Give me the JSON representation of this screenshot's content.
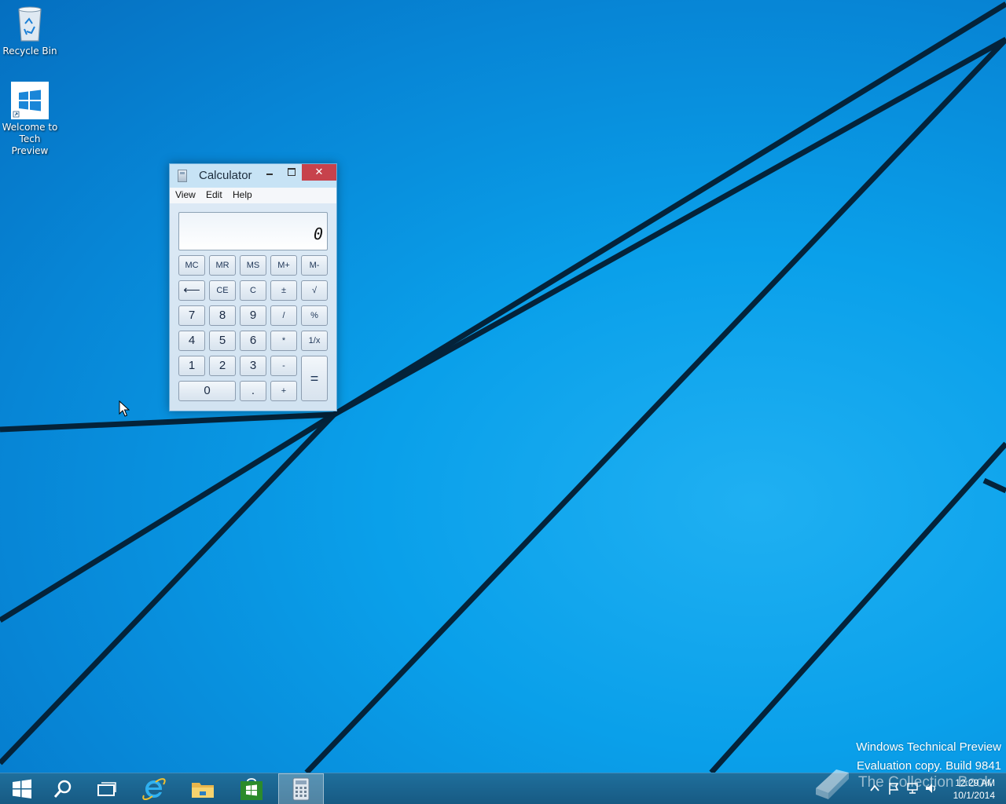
{
  "desktop": {
    "icons": [
      {
        "label": "Recycle Bin",
        "icon": "recycle-bin-icon"
      },
      {
        "label_line1": "Welcome to",
        "label_line2": "Tech Preview",
        "icon": "windows-logo-icon"
      }
    ]
  },
  "calculator": {
    "title": "Calculator",
    "window_buttons": {
      "minimize": "–",
      "maximize": "□",
      "close": "✕"
    },
    "menu": [
      "View",
      "Edit",
      "Help"
    ],
    "display_value": "0",
    "keys": {
      "mc": "MC",
      "mr": "MR",
      "ms": "MS",
      "mplus": "M+",
      "mminus": "M-",
      "back": "⟵",
      "ce": "CE",
      "c": "C",
      "plusminus": "±",
      "sqrt": "√",
      "n7": "7",
      "n8": "8",
      "n9": "9",
      "divide": "/",
      "percent": "%",
      "n4": "4",
      "n5": "5",
      "n6": "6",
      "multiply": "*",
      "reciprocal": "1/x",
      "n1": "1",
      "n2": "2",
      "n3": "3",
      "minus": "-",
      "equals": "=",
      "n0": "0",
      "decimal": ".",
      "plus": "+"
    },
    "colors": {
      "close_button": "#c7424c",
      "frame": "#c7e3f5"
    }
  },
  "taskbar": {
    "items": [
      "start-icon",
      "search-icon",
      "task-view-icon",
      "internet-explorer-icon",
      "file-explorer-icon",
      "store-icon",
      "calculator-icon"
    ],
    "active": "calculator-icon",
    "tray_icons": [
      "show-hidden-icons-icon",
      "action-center-flag-icon",
      "network-icon",
      "volume-icon"
    ],
    "time": "12:29 AM",
    "date": "10/1/2014"
  },
  "watermark": {
    "line1": "Windows Technical Preview",
    "line2": "Evaluation copy. Build 9841",
    "collection_text": "The Collection Book"
  },
  "colors": {
    "wallpaper": "#0aa0ea",
    "taskbar": "#1f6f9c"
  }
}
